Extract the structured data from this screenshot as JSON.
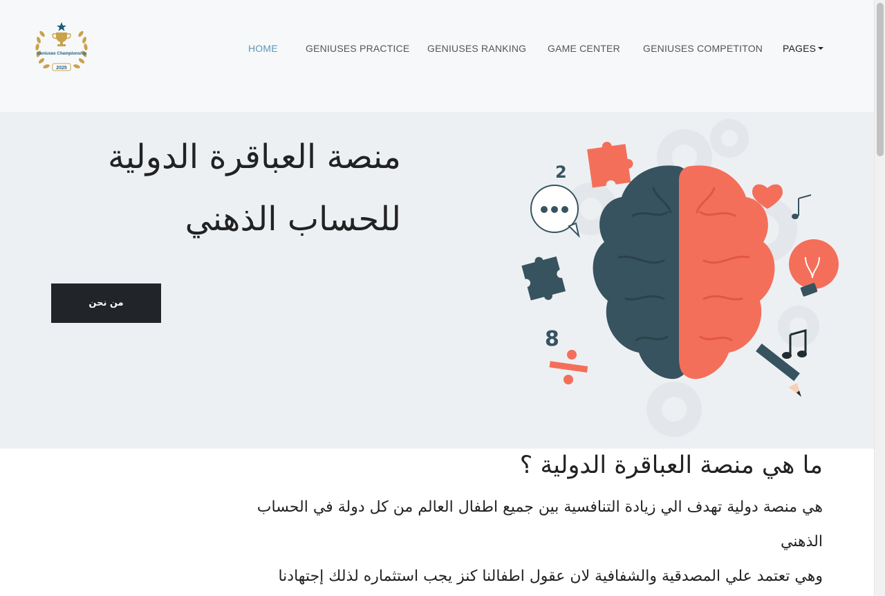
{
  "header": {
    "logo": {
      "name": "geniuses-championship-logo",
      "text": "Geniuses Championship",
      "year": "2025"
    },
    "nav": [
      {
        "label": "HOME",
        "active": true
      },
      {
        "label": "GENIUSES PRACTICE",
        "active": false
      },
      {
        "label": "GENIUSES RANKING",
        "active": false
      },
      {
        "label": "GAME CENTER",
        "active": false
      },
      {
        "label": "GENIUSES COMPETITON",
        "active": false
      },
      {
        "label": "PAGES",
        "active": false,
        "dropdown": true
      }
    ]
  },
  "hero": {
    "title_line1": "منصة العباقرة الدولية",
    "title_line2": "للحساب الذهني",
    "button_label": "من نحن",
    "illustration": {
      "name": "brain-illustration",
      "left_color": "#37535f",
      "right_color": "#f46f5a",
      "number_top": "2",
      "number_bottom": "8"
    }
  },
  "about": {
    "title": "ما هي منصة العباقرة الدولية ؟",
    "line1": "هي منصة دولية تهدف الي زيادة التنافسية بين جميع اطفال العالم من كل دولة في الحساب",
    "line2": "الذهني",
    "line3": "وهي تعتمد علي المصدقية والشفافية لان عقول اطفالنا كنز يجب استثماره لذلك إجتهادنا"
  },
  "colors": {
    "header_bg": "#f7f8fa",
    "hero_bg": "#edf0f3",
    "nav_active": "#5a98b8",
    "button_bg": "#212529",
    "accent_red": "#f46f5a",
    "accent_dark": "#37535f"
  }
}
